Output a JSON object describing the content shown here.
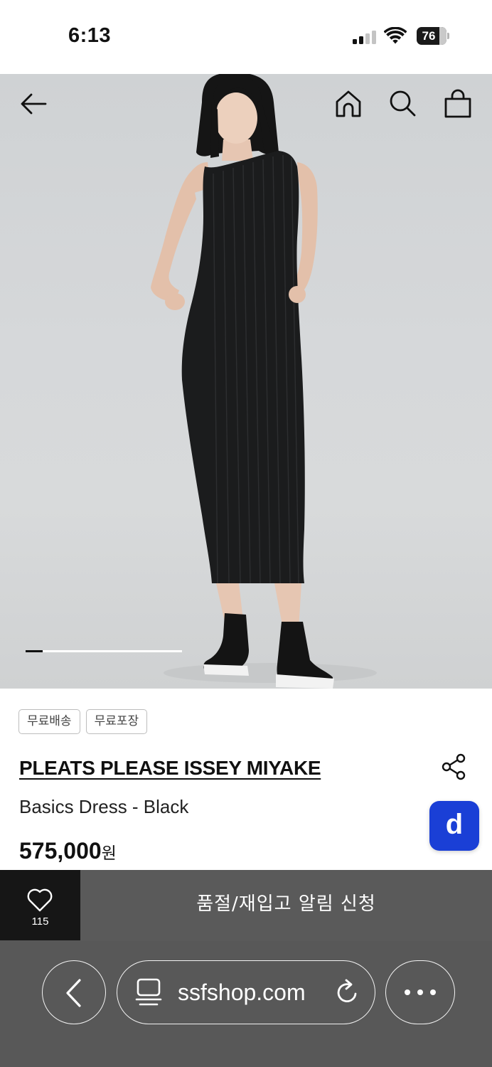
{
  "status_bar": {
    "time": "6:13",
    "battery_level": "76",
    "signal_bars_active": 2,
    "signal_bars_total": 4
  },
  "header": {
    "back_icon": "arrow-left-icon",
    "home_icon": "home-icon",
    "search_icon": "search-icon",
    "cart_icon": "shopping-bag-icon"
  },
  "gallery": {
    "progress_fraction": 0.11
  },
  "product": {
    "badges": [
      "무료배송",
      "무료포장"
    ],
    "brand": "PLEATS PLEASE ISSEY MIYAKE",
    "name": "Basics Dress - Black",
    "price": "575,000",
    "currency": "원",
    "share_icon": "share-icon"
  },
  "chat_button": {
    "label": "d",
    "color": "#1a3fd6"
  },
  "action_bar": {
    "wish_icon": "heart-icon",
    "wish_count": "115",
    "restock_label": "품절/재입고 알림 신청"
  },
  "browser": {
    "url": "ssfshop.com",
    "back_icon": "chevron-left-icon",
    "reader_icon": "reader-icon",
    "reload_icon": "reload-icon",
    "more_icon": "more-icon"
  },
  "colors": {
    "accent": "#1a3fd6",
    "action_bar_bg": "#5a5a5a",
    "wish_bg": "#161616",
    "browser_bg": "#585858"
  }
}
